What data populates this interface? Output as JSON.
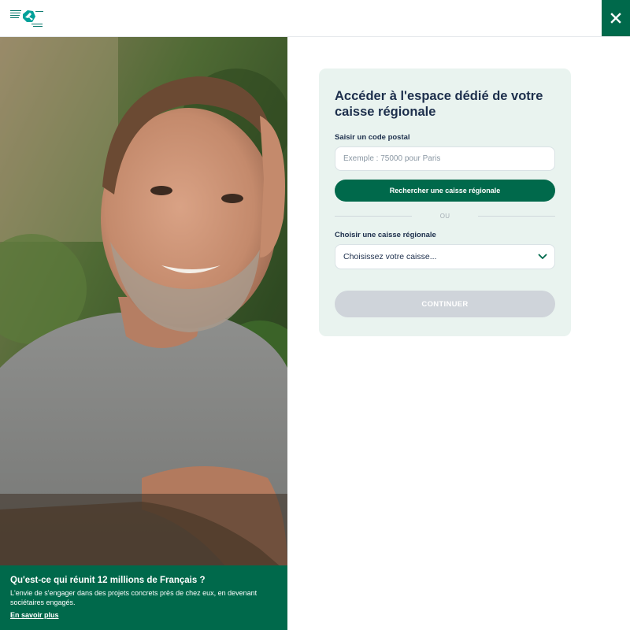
{
  "header": {
    "logo_name": "credit-agricole-logo",
    "close_icon": "close-icon",
    "brand_color": "#00694b"
  },
  "promo": {
    "title": "Qu'est-ce qui réunit 12 millions de Français ?",
    "text": "L'envie de s'engager dans des projets concrets près de chez eux, en devenant sociétaires engagés.",
    "link": "En savoir plus"
  },
  "form": {
    "title": "Accéder à l'espace dédié de votre caisse régionale",
    "postal_label": "Saisir un code postal",
    "postal_placeholder": "Exemple : 75000 pour Paris",
    "postal_value": "",
    "search_button": "Rechercher une caisse régionale",
    "separator": "OU",
    "select_label": "Choisir une caisse régionale",
    "select_value": "Choisissez votre caisse...",
    "select_icon": "chevron-down-icon",
    "continue_button": "CONTINUER",
    "continue_disabled": true
  },
  "colors": {
    "card_background": "#e9f3ef",
    "title_color": "#1d2f4c",
    "disabled_button": "#cfd4da"
  }
}
